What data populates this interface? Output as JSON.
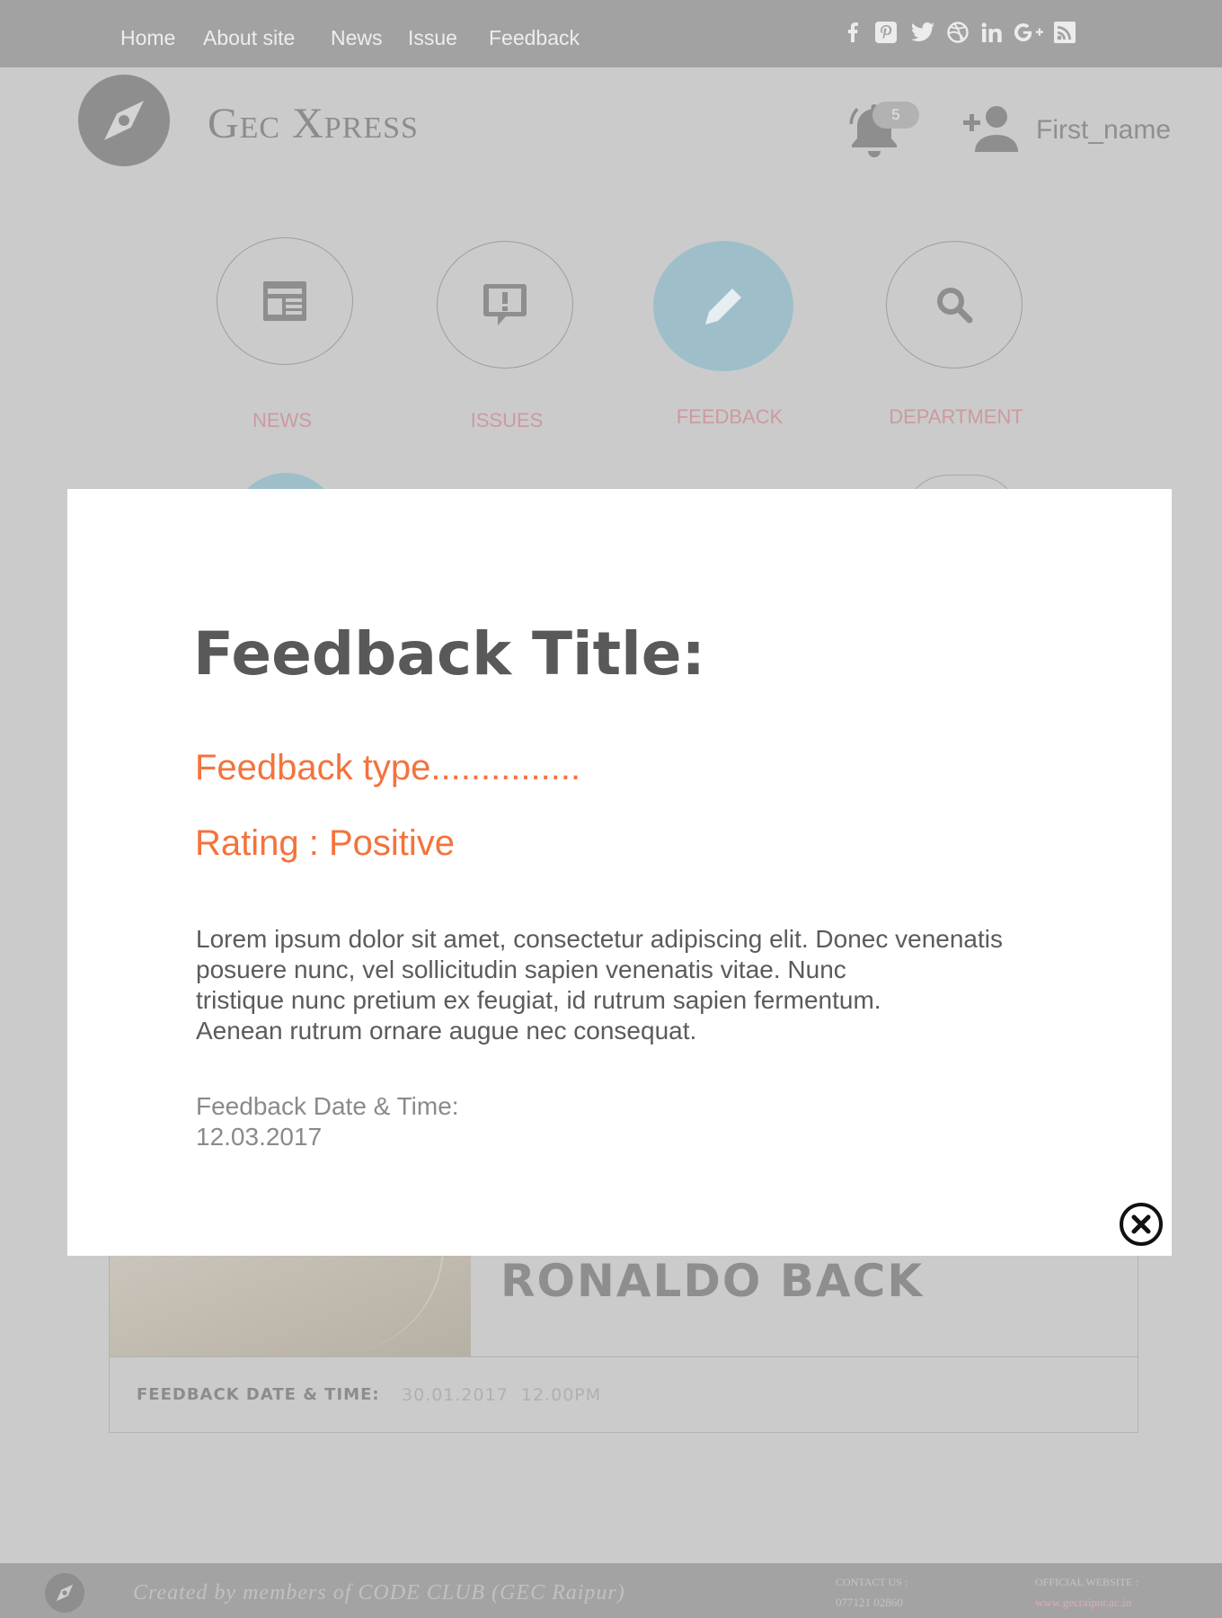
{
  "topnav": {
    "links": [
      "Home",
      "About site",
      "News",
      "Issue",
      "Feedback"
    ],
    "social_icons": [
      "facebook-icon",
      "pinterest-icon",
      "twitter-icon",
      "dribbble-icon",
      "linkedin-icon",
      "google-plus-icon",
      "rss-icon"
    ]
  },
  "header": {
    "site_title": "Gec Xpress",
    "notification_count": "5",
    "username": "First_name",
    "logo_icon": "compass-icon"
  },
  "categories": [
    {
      "label": "NEWS",
      "icon": "newspaper-icon",
      "active": false
    },
    {
      "label": "ISSUES",
      "icon": "feedback-alert-icon",
      "active": false
    },
    {
      "label": "FEEDBACK",
      "icon": "pencil-icon",
      "active": true
    },
    {
      "label": "DEPARTMENT",
      "icon": "search-icon",
      "active": false
    }
  ],
  "background_card": {
    "title": "RONALDO BACK",
    "footer_label": "FEEDBACK DATE & TIME:",
    "footer_date": "30.01.2017",
    "footer_time": "12.00PM"
  },
  "modal": {
    "title": "Feedback Title:",
    "type": "Feedback type...............",
    "rating": "Rating : Positive",
    "body_lines": [
      "Lorem ipsum dolor sit amet, consectetur adipiscing elit. Donec venenatis",
      "posuere nunc, vel sollicitudin sapien venenatis vitae. Nunc",
      "tristique nunc pretium ex feugiat, id rutrum sapien fermentum.",
      "Aenean rutrum ornare augue nec consequat."
    ],
    "date_label": "Feedback Date & Time:",
    "date_value": "12.03.2017",
    "close_icon": "close-circle-icon"
  },
  "footer": {
    "credit": "Created by members of CODE CLUB (GEC Raipur)",
    "contact_label": "CONTACT US :",
    "contact_value": "077121 02860",
    "website_label": "OFFICIAL WEBSITE :",
    "website_value": "www.gecraipur.ac.in"
  },
  "colors": {
    "accent_orange": "#f4733c",
    "active_circle": "#9ebfc9",
    "category_label": "#cc9aa0",
    "overlay_gray": "#cbcbcb",
    "link_pink": "#e0a9b6"
  }
}
